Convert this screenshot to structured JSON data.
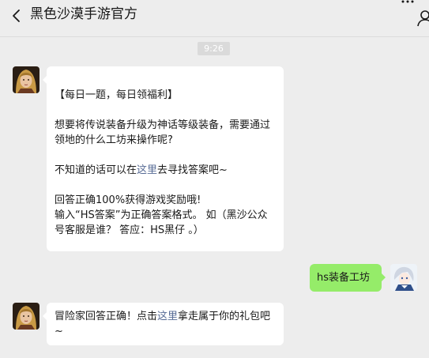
{
  "header": {
    "title": "黑色沙漠手游官方"
  },
  "timestamp": "9:26",
  "messages": {
    "m1": {
      "line1": "【每日一题，每日领福利】",
      "line2": "想要将传说装备升级为神话等级装备，需要通过领地的什么工坊来操作呢?",
      "line3_pre": "不知道的话可以在",
      "line3_link": "这里",
      "line3_post": "去寻找答案吧~",
      "line4": "回答正确100%获得游戏奖励哦!",
      "line5": "输入“HS答案”为正确答案格式。 如（黑沙公众号客服是谁？ 答应：HS黑仔 。）"
    },
    "reply": "hs装备工坊",
    "m2": {
      "pre": "冒险家回答正确！点击",
      "link": "这里",
      "post": "拿走属于你的礼包吧~"
    }
  },
  "colors": {
    "background": "#ededed",
    "my_bubble": "#95ec69",
    "link": "#576b95"
  },
  "icons": {
    "back": "chevron-left-icon",
    "profile": "person-icon",
    "more": "more-dots-icon"
  }
}
